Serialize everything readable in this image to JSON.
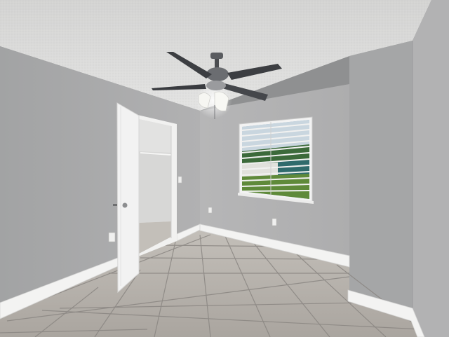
{
  "scene": {
    "kind": "photograph",
    "subject": "empty-bedroom-interior",
    "colors": {
      "ceiling": "#dcdcdb",
      "wall_left": "#a9a9aa",
      "wall_back": "#b3b3b4",
      "wall_right_near": "#a6a7a8",
      "wall_right_far": "#b0b0b1",
      "floor_tile": "#b8b3ad",
      "grout": "#8a8682",
      "baseboard": "#f3f3f2",
      "door": "#f2f2f2",
      "closet_interior": "#d9d9d8",
      "lawn": "#5f8a3a",
      "fan_metal": "#4a4c50",
      "fan_light": "#f4f4ef"
    }
  }
}
